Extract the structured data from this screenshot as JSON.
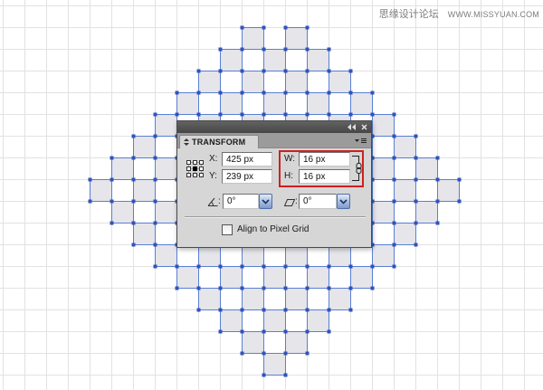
{
  "watermark": {
    "name": "思缘设计论坛",
    "url": "WWW.MISSYUAN.COM"
  },
  "panel": {
    "title_bar": {
      "collapse_icon": "double-chevron-left-icon",
      "close_icon": "close-icon"
    },
    "tab": {
      "label": "TRANSFORM",
      "icon": "show-options-icon"
    },
    "menu_icon": "panel-menu-icon",
    "reference_point_icon": "reference-point-locator-icon",
    "fields": {
      "x": {
        "label": "X:",
        "value": "425 px"
      },
      "y": {
        "label": "Y:",
        "value": "239 px"
      },
      "w": {
        "label": "W:",
        "value": "16 px"
      },
      "h": {
        "label": "H:",
        "value": "16 px"
      },
      "rotate": {
        "icon": "rotate-angle-icon",
        "label": ":",
        "value": "0°"
      },
      "shear": {
        "icon": "shear-icon",
        "label": ":",
        "value": "0°"
      }
    },
    "constrain_proportions_icon": "chain-link-icon",
    "align_to_pixel_grid": {
      "label": "Align to Pixel Grid",
      "checked": false
    }
  },
  "colors": {
    "highlight_box": "#d11f1f",
    "artwork_fill": "#e5e5ea",
    "artwork_stroke": "#5a7fd2",
    "anchor_point": "#3153b8",
    "grid_line": "#e2e2e2"
  }
}
